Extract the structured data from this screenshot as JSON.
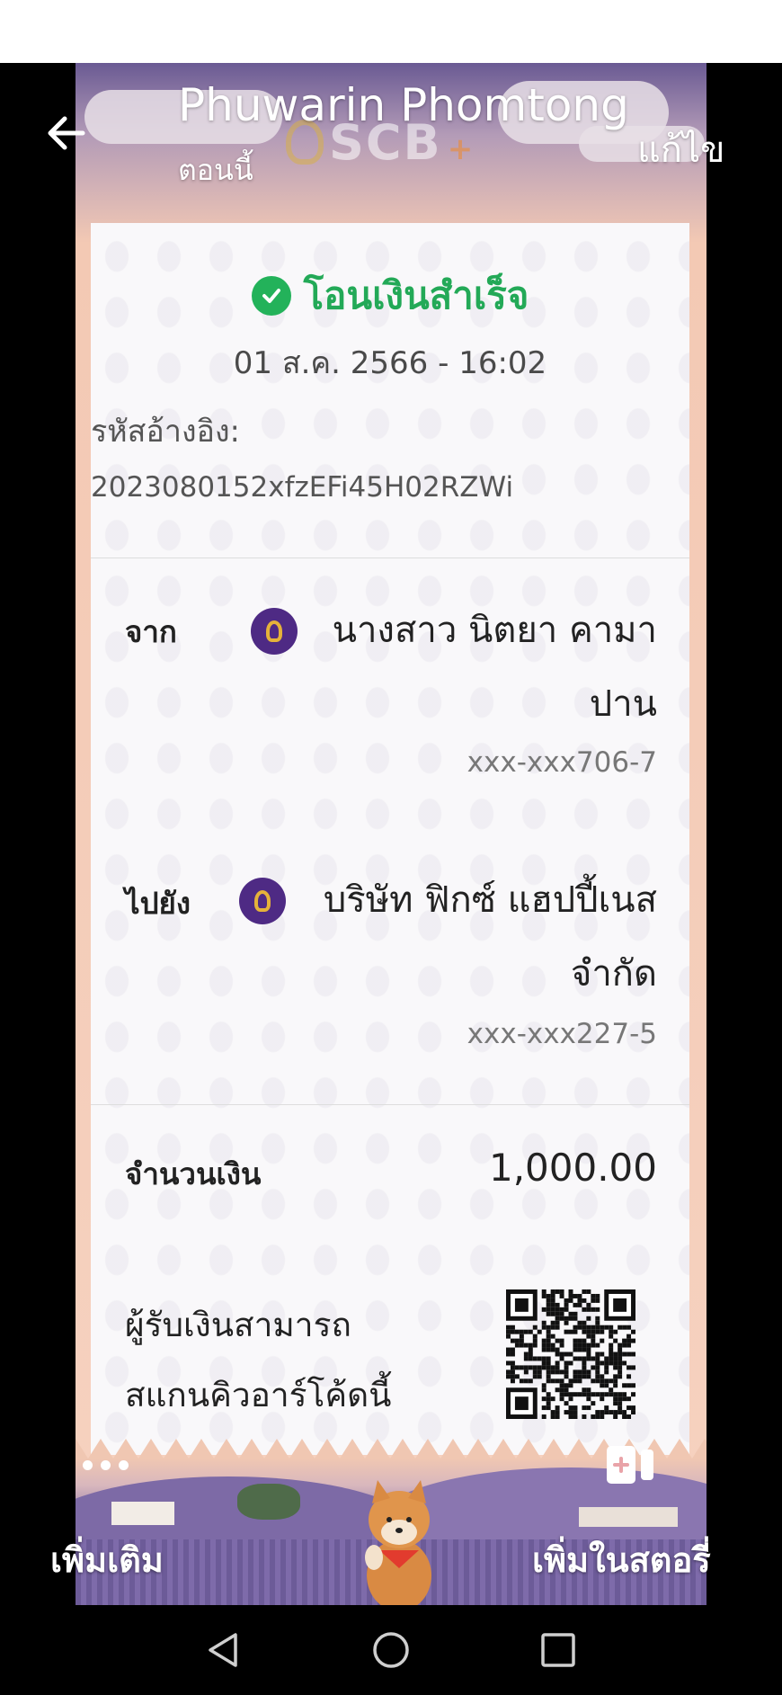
{
  "story": {
    "poster_name": "Phuwarin Phomtong",
    "time_ago": "ตอนนี้",
    "edit_label": "แก้ไข",
    "more_label": "เพิ่มเติม",
    "add_to_story_label": "เพิ่มในสตอรี่",
    "icons": [
      "back-arrow-icon",
      "more-dots-icon",
      "add-story-icon"
    ]
  },
  "scb_logo": {
    "text": "SCB",
    "plus": "+"
  },
  "receipt": {
    "status": "โอนเงินสำเร็จ",
    "datetime": "01 ส.ค. 2566 - 16:02",
    "reference_label": "รหัสอ้างอิง:",
    "reference_value": "2023080152xfzEFi45H02RZWi",
    "from": {
      "label": "จาก",
      "name_line1": "นางสาว นิตยา คามา",
      "name_line2": "ปาน",
      "account": "xxx-xxx706-7"
    },
    "to": {
      "label": "ไปยัง",
      "name_line1": "บริษัท ฟิกซ์ แฮปปี้เนส",
      "name_line2": "จำกัด",
      "account": "xxx-xxx227-5"
    },
    "amount_label": "จำนวนเงิน",
    "amount_value": "1,000.00",
    "qr_text_line1": "ผู้รับเงินสามารถ",
    "qr_text_line2": "สแกนคิวอาร์โค้ดนี้"
  },
  "colors": {
    "success": "#23a957",
    "scb_purple": "#4e2a84",
    "scb_gold": "#e5b23a"
  },
  "navigation": {
    "icons": [
      "nav-back-icon",
      "nav-home-icon",
      "nav-recents-icon"
    ]
  }
}
